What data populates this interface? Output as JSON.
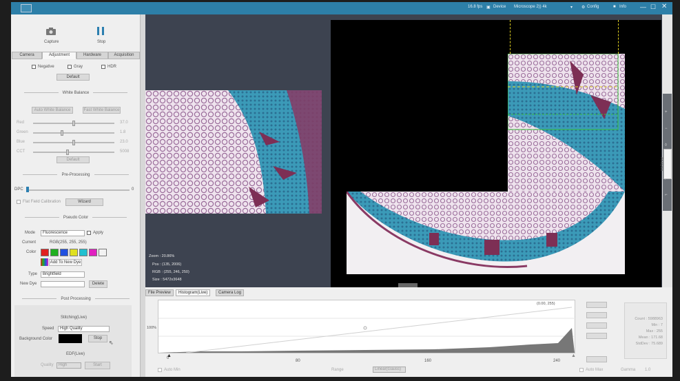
{
  "titlebar": {
    "fps": "16.8 fps",
    "device_label": "Device",
    "device_name": "Microscope 2)) 4k",
    "config_label": "Config",
    "info_label": "Info"
  },
  "left_panel": {
    "capture_label": "Capture",
    "stop_label": "Stop",
    "tabs": [
      "Camera",
      "Adjustment",
      "Hardware",
      "Acquisition"
    ],
    "active_tab": "Adjustment",
    "negative_label": "Negative",
    "gray_label": "Gray",
    "hdr_label": "HDR",
    "default_label": "Default",
    "white_balance_title": "White Balance",
    "auto_wb_label": "Auto White Balance",
    "one_push_label": "Fast White Balance",
    "sliders": [
      {
        "label": "Red",
        "value_text": "37.0",
        "level": 0.5
      },
      {
        "label": "Green",
        "value_text": "1.8",
        "level": 0.35
      },
      {
        "label": "Blue",
        "value_text": "23.0",
        "level": 0.5
      },
      {
        "label": "CCT",
        "value_text": "5008",
        "level": 0.42
      }
    ],
    "wb_default_label": "Default",
    "pre_processing_title": "Pre-Processing",
    "dpc_label": "DPC",
    "dpc_value": "0",
    "flat_field_label": "Flat Field Calibration",
    "wizard_label": "Wizard",
    "pseudo_color_title": "Pseudo Color",
    "mode_label": "Mode",
    "mode_value": "Fluorescence",
    "apply_label": "Apply",
    "current_label": "Current",
    "current_value": "RGB(255, 255, 255)",
    "color_label": "Color",
    "colors": [
      "#e02020",
      "#20b020",
      "#2050e0",
      "#e0e020",
      "#20c0d0",
      "#e020c0",
      "#f2f2f2"
    ],
    "add_dye_label": "Add To New Dye",
    "type_label": "Type",
    "type_value": "Brightfield",
    "new_dye_label": "New Dye",
    "delete_label": "Delete",
    "post_processing_title": "Post Processing",
    "stitching_title": "Stitching(Live)",
    "speed_label": "Speed",
    "speed_value": "High Quality",
    "bg_color_label": "Background Color",
    "bg_color": "#000000",
    "stop_label2": "Stop",
    "edf_title": "EDF(Live)",
    "quality_label": "Quality",
    "quality_value": "High",
    "start_label": "Start"
  },
  "viewer": {
    "zoom_text": "Zoom : 20.86%",
    "pos_text": "Pos : (135, 2006)",
    "rgb_text": "RGB : (255, 246, 250)",
    "size_text": "Size : 5472x3648"
  },
  "right_strip": {
    "analysis_label": "Analysis"
  },
  "bottom": {
    "tabs": [
      "File Preview",
      "Histogram(Live)",
      "Camera Log"
    ],
    "active_tab": "Histogram(Live)",
    "y_label": "100%",
    "corner_value": "(0.00, 255)",
    "x_ticks": [
      "0",
      "80",
      "160",
      "240"
    ],
    "auto_min_label": "Auto Min",
    "range_label": "Range",
    "range_value": "Linear(Gauss)",
    "auto_max_label": "Auto Max",
    "stats": [
      "Count : 5988963",
      "Min : 7",
      "Max : 255",
      "Mean : 171.68",
      "StdDev : 75.689"
    ],
    "gamma_label": "Gamma",
    "gamma_value": "1.0"
  }
}
